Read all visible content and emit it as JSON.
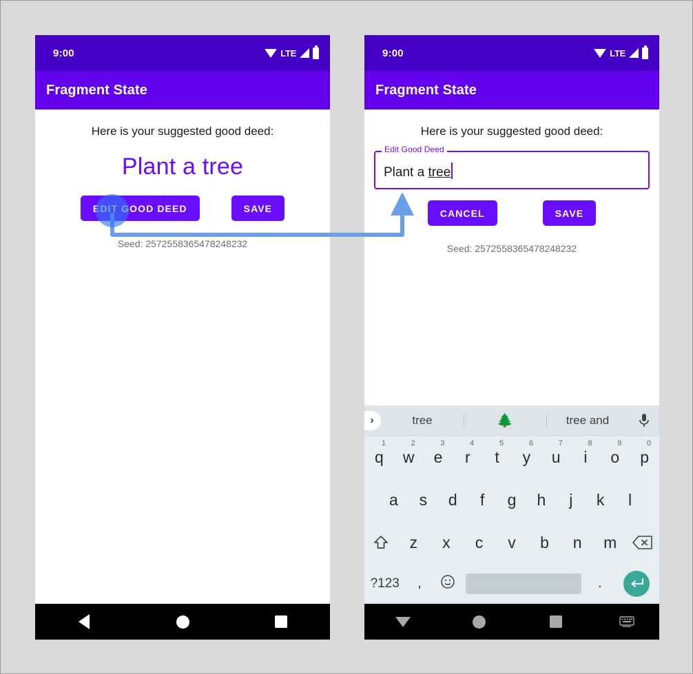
{
  "background_color": "#d9d9d9",
  "colors": {
    "status_bar": "#4400c4",
    "app_bar": "#6200ee",
    "primary": "#6a0dfd",
    "deed_text": "#6a0dfd",
    "annotation_arrow": "#6a9fe8",
    "tap_indicator": "#2d78f5",
    "keyboard_bg": "#e8edef",
    "suggestion_bg": "#dfe4e7",
    "enter_key": "#3aa99a",
    "spacebar": "#c6cdd0",
    "seed_text": "#6f6f6f"
  },
  "phones": [
    {
      "id": "phone-left",
      "state_name": "view-mode",
      "status_bar": {
        "time": "9:00",
        "icons": [
          "wifi-icon",
          "lte-label",
          "signal-icon",
          "battery-icon"
        ],
        "network_label": "LTE"
      },
      "app_bar": {
        "title": "Fragment State"
      },
      "content": {
        "prompt": "Here is your suggested good deed:",
        "deed": "Plant a tree",
        "buttons": [
          {
            "name": "edit-good-deed-button",
            "label": "EDIT GOOD DEED"
          },
          {
            "name": "save-button",
            "label": "SAVE"
          }
        ],
        "seed": "Seed: 2572558365478248232"
      },
      "nav_bar": {
        "buttons": [
          {
            "name": "nav-back-button",
            "icon": "triangle-left-icon"
          },
          {
            "name": "nav-home-button",
            "icon": "circle-icon"
          },
          {
            "name": "nav-recents-button",
            "icon": "square-icon"
          }
        ]
      }
    },
    {
      "id": "phone-right",
      "state_name": "edit-mode",
      "status_bar": {
        "time": "9:00",
        "icons": [
          "wifi-icon",
          "lte-label",
          "signal-icon",
          "battery-icon"
        ],
        "network_label": "LTE"
      },
      "app_bar": {
        "title": "Fragment State"
      },
      "content": {
        "prompt": "Here is your suggested good deed:",
        "text_field": {
          "label": "Edit Good Deed",
          "value_static": "Plant a ",
          "value_composing": "tree",
          "full_value": "Plant a tree"
        },
        "buttons": [
          {
            "name": "cancel-button",
            "label": "CANCEL"
          },
          {
            "name": "save-button",
            "label": "SAVE"
          }
        ],
        "seed": "Seed: 2572558365478248232"
      },
      "keyboard": {
        "suggestions": [
          {
            "type": "word",
            "text": "tree"
          },
          {
            "type": "emoji",
            "text": "🌲"
          },
          {
            "type": "word",
            "text": "tree and"
          }
        ],
        "expand_icon": "chevron-right-icon",
        "mic_icon": "microphone-icon",
        "row1": [
          {
            "key": "q",
            "num": "1"
          },
          {
            "key": "w",
            "num": "2"
          },
          {
            "key": "e",
            "num": "3"
          },
          {
            "key": "r",
            "num": "4"
          },
          {
            "key": "t",
            "num": "5"
          },
          {
            "key": "y",
            "num": "6"
          },
          {
            "key": "u",
            "num": "7"
          },
          {
            "key": "i",
            "num": "8"
          },
          {
            "key": "o",
            "num": "9"
          },
          {
            "key": "p",
            "num": "0"
          }
        ],
        "row2": [
          "a",
          "s",
          "d",
          "f",
          "g",
          "h",
          "j",
          "k",
          "l"
        ],
        "row3": {
          "shift_icon": "shift-up-icon",
          "keys": [
            "z",
            "x",
            "c",
            "v",
            "b",
            "n",
            "m"
          ],
          "backspace_icon": "backspace-icon"
        },
        "row4": {
          "symbols_label": "?123",
          "comma": ",",
          "emoji_icon": "smiley-icon",
          "space_label": "",
          "period": ".",
          "enter_icon": "enter-return-icon"
        }
      },
      "nav_bar": {
        "buttons": [
          {
            "name": "nav-hide-keyboard-button",
            "icon": "triangle-down-icon"
          },
          {
            "name": "nav-home-button",
            "icon": "circle-icon"
          },
          {
            "name": "nav-recents-button",
            "icon": "square-icon"
          },
          {
            "name": "nav-keyboard-switch-button",
            "icon": "keyboard-icon"
          }
        ]
      }
    }
  ],
  "annotation": {
    "type": "flow-arrow",
    "from": "edit-good-deed-button",
    "to": "edit-good-deed-text-field",
    "tap_indicator": true
  }
}
